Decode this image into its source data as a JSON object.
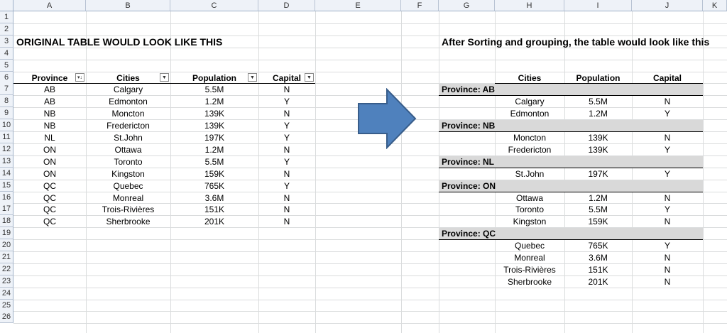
{
  "columns": [
    "A",
    "B",
    "C",
    "D",
    "E",
    "F",
    "G",
    "H",
    "I",
    "J",
    "K"
  ],
  "rows": [
    "1",
    "2",
    "3",
    "4",
    "5",
    "6",
    "7",
    "8",
    "9",
    "10",
    "11",
    "12",
    "13",
    "14",
    "15",
    "16",
    "17",
    "18",
    "19",
    "20",
    "21",
    "22",
    "23",
    "24",
    "25",
    "26"
  ],
  "left_title": "ORIGINAL TABLE WOULD LOOK LIKE THIS",
  "right_title": "After Sorting and grouping, the table would look like this",
  "original_table": {
    "headers": [
      "Province",
      "Cities",
      "Population",
      "Capital"
    ],
    "rows": [
      [
        "AB",
        "Calgary",
        "5.5M",
        "N"
      ],
      [
        "AB",
        "Edmonton",
        "1.2M",
        "Y"
      ],
      [
        "NB",
        "Moncton",
        "139K",
        "N"
      ],
      [
        "NB",
        "Fredericton",
        "139K",
        "Y"
      ],
      [
        "NL",
        "St.John",
        "197K",
        "Y"
      ],
      [
        "ON",
        "Ottawa",
        "1.2M",
        "N"
      ],
      [
        "ON",
        "Toronto",
        "5.5M",
        "Y"
      ],
      [
        "ON",
        "Kingston",
        "159K",
        "N"
      ],
      [
        "QC",
        "Quebec",
        "765K",
        "Y"
      ],
      [
        "QC",
        "Monreal",
        "3.6M",
        "N"
      ],
      [
        "QC",
        "Trois-Rivières",
        "151K",
        "N"
      ],
      [
        "QC",
        "Sherbrooke",
        "201K",
        "N"
      ]
    ]
  },
  "grouped_table": {
    "headers": [
      "Cities",
      "Population",
      "Capital"
    ],
    "groups": [
      {
        "label": "Province: AB",
        "rows": [
          [
            "Calgary",
            "5.5M",
            "N"
          ],
          [
            "Edmonton",
            "1.2M",
            "Y"
          ]
        ]
      },
      {
        "label": "Province: NB",
        "rows": [
          [
            "Moncton",
            "139K",
            "N"
          ],
          [
            "Fredericton",
            "139K",
            "Y"
          ]
        ]
      },
      {
        "label": "Province: NL",
        "rows": [
          [
            "St.John",
            "197K",
            "Y"
          ]
        ]
      },
      {
        "label": "Province: ON",
        "rows": [
          [
            "Ottawa",
            "1.2M",
            "N"
          ],
          [
            "Toronto",
            "5.5M",
            "Y"
          ],
          [
            "Kingston",
            "159K",
            "N"
          ]
        ]
      },
      {
        "label": "Province: QC",
        "rows": [
          [
            "Quebec",
            "765K",
            "Y"
          ],
          [
            "Monreal",
            "3.6M",
            "N"
          ],
          [
            "Trois-Rivières",
            "151K",
            "N"
          ],
          [
            "Sherbrooke",
            "201K",
            "N"
          ]
        ]
      }
    ]
  },
  "colors": {
    "header_bg": "#eef2f8",
    "gridline": "#dadcdd",
    "group_band": "#d9d9d9",
    "arrow_fill": "#4f81bd",
    "arrow_stroke": "#385d8a"
  },
  "icons": {
    "filter": "dropdown-filter-icon",
    "sort_filter": "sort-filter-icon",
    "arrow": "right-arrow-shape"
  }
}
